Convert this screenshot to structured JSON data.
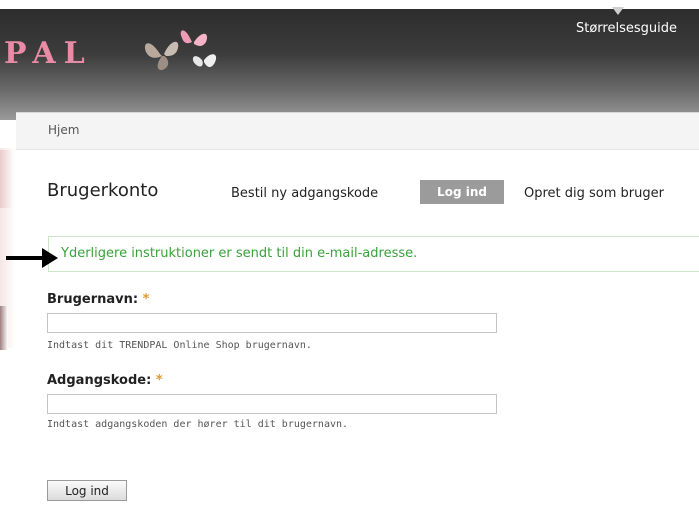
{
  "header": {
    "logo_text": "PAL",
    "size_guide_label": "Størrelsesguide"
  },
  "breadcrumb": {
    "home_label": "Hjem"
  },
  "page": {
    "title": "Brugerkonto",
    "tabs": [
      {
        "label": "Bestil ny adgangskode"
      },
      {
        "label": "Log ind"
      },
      {
        "label": "Opret dig som bruger"
      }
    ]
  },
  "status_message": "Yderligere instruktioner er sendt til din e-mail-adresse.",
  "form": {
    "username_label": "Brugernavn:",
    "username_value": "",
    "username_hint": "Indtast dit TRENDPAL Online Shop brugernavn.",
    "password_label": "Adgangskode:",
    "password_value": "",
    "password_hint": "Indtast adgangskoden der hører til dit brugernavn.",
    "required_marker": "*",
    "submit_label": "Log ind"
  },
  "colors": {
    "logo": "#e98aa6",
    "message_text": "#3aa13a",
    "required": "#e09a2a",
    "active_tab": "#9b9b9b"
  }
}
